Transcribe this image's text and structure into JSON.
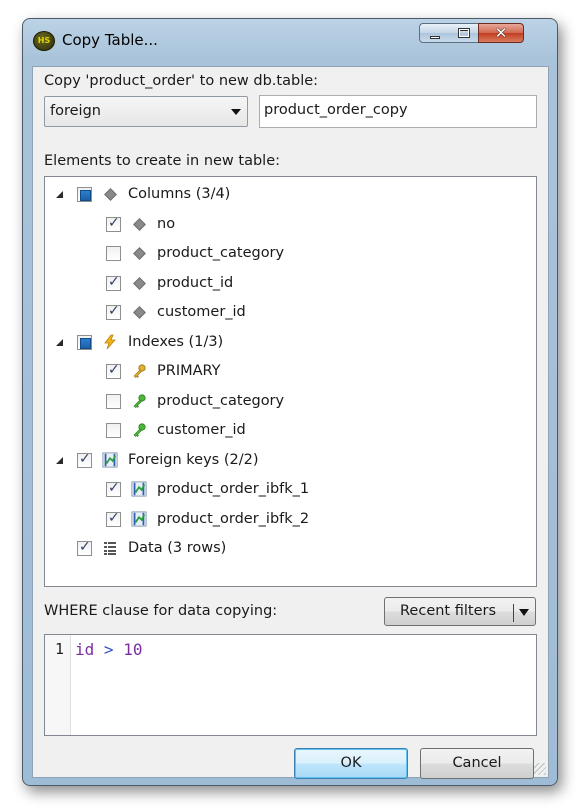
{
  "window": {
    "title": "Copy Table...",
    "app_icon_text": "HS"
  },
  "form": {
    "copy_label": "Copy 'product_order' to new db.table:",
    "database_select_value": "foreign",
    "new_table_name": "product_order_copy",
    "elements_label": "Elements to create in new table:",
    "where_label": "WHERE clause for data copying:",
    "recent_filters_label": "Recent filters"
  },
  "tree": {
    "columns": {
      "label": "Columns (3/4)",
      "state": "partial",
      "items": [
        {
          "label": "no",
          "checked": true
        },
        {
          "label": "product_category",
          "checked": false
        },
        {
          "label": "product_id",
          "checked": true
        },
        {
          "label": "customer_id",
          "checked": true
        }
      ]
    },
    "indexes": {
      "label": "Indexes (1/3)",
      "state": "partial",
      "items": [
        {
          "label": "PRIMARY",
          "checked": true,
          "icon": "primary-key-icon"
        },
        {
          "label": "product_category",
          "checked": false,
          "icon": "index-key-icon"
        },
        {
          "label": "customer_id",
          "checked": false,
          "icon": "index-key-icon"
        }
      ]
    },
    "foreign_keys": {
      "label": "Foreign keys (2/2)",
      "state": "checked",
      "items": [
        {
          "label": "product_order_ibfk_1",
          "checked": true
        },
        {
          "label": "product_order_ibfk_2",
          "checked": true
        }
      ]
    },
    "data": {
      "label": "Data (3 rows)",
      "checked": true
    }
  },
  "editor": {
    "line_number": "1",
    "tokens": {
      "ident": "id",
      "op": ">",
      "num": "10"
    }
  },
  "buttons": {
    "ok": "OK",
    "cancel": "Cancel"
  },
  "colors": {
    "accent": "#3c7fb1",
    "key_gold": "#d4a017",
    "key_green": "#3aa02a",
    "lightning": "#f2b515"
  }
}
